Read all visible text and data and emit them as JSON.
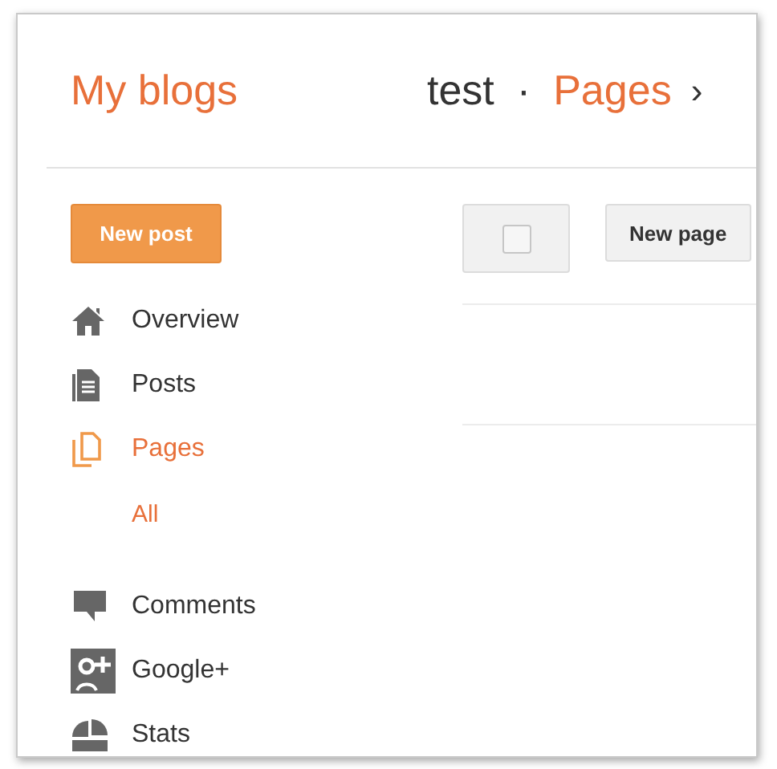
{
  "header": {
    "title": "My blogs",
    "blog_name": "test",
    "separator": "·",
    "section": "Pages",
    "chevron": "›"
  },
  "new_post_button": "New post",
  "sidebar": {
    "items": [
      {
        "label": "Overview",
        "selected": false
      },
      {
        "label": "Posts",
        "selected": false
      },
      {
        "label": "Pages",
        "selected": true,
        "children": [
          {
            "label": "All",
            "selected": true
          }
        ]
      },
      {
        "label": "Comments",
        "selected": false
      },
      {
        "label": "Google+",
        "selected": false
      },
      {
        "label": "Stats",
        "selected": false
      }
    ]
  },
  "toolbar": {
    "select_all_checked": false,
    "new_page_button": "New page"
  }
}
